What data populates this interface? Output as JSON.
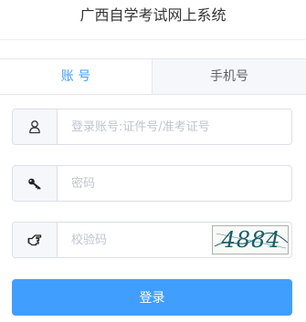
{
  "header": {
    "title": "广西自学考试网上系统"
  },
  "tabs": [
    {
      "label": "账 号",
      "active": true
    },
    {
      "label": "手机号",
      "active": false
    }
  ],
  "form": {
    "account": {
      "placeholder": "登录账号:证件号/准考证号",
      "value": "",
      "icon": "user-icon"
    },
    "password": {
      "placeholder": "密码",
      "value": "",
      "icon": "key-icon"
    },
    "captcha": {
      "placeholder": "校验码",
      "value": "",
      "icon": "pointing-hand-icon",
      "image_text": "4884"
    }
  },
  "login_button": {
    "label": "登录"
  },
  "colors": {
    "accent": "#409eff",
    "border": "#dcdfe6",
    "prepend_bg": "#f5f7fa",
    "placeholder": "#c0c4cc",
    "title_text": "#333333"
  }
}
